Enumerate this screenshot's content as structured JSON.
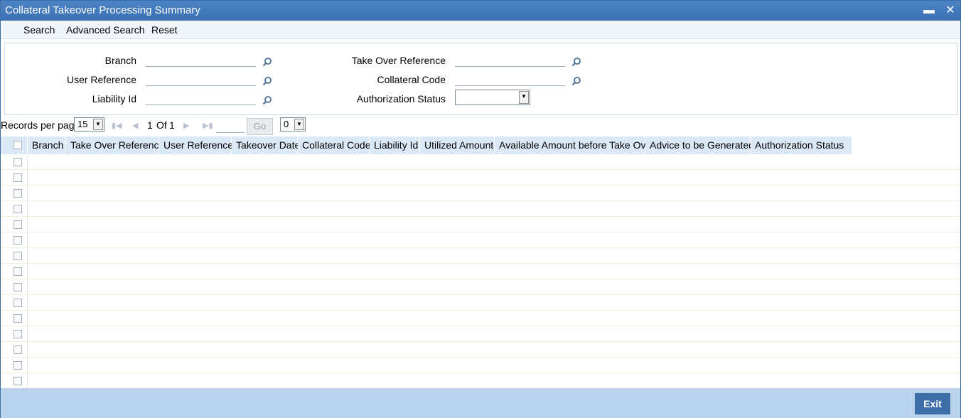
{
  "window": {
    "title": "Collateral Takeover Processing Summary",
    "minimize_icon": "minimize-icon",
    "close_icon": "close-icon"
  },
  "menu": {
    "search": "Search",
    "advanced_search": "Advanced Search",
    "reset": "Reset"
  },
  "criteria": {
    "branch": {
      "label": "Branch",
      "value": ""
    },
    "user_reference": {
      "label": "User Reference",
      "value": ""
    },
    "liability_id": {
      "label": "Liability Id",
      "value": ""
    },
    "take_over_reference": {
      "label": "Take Over Reference",
      "value": ""
    },
    "collateral_code": {
      "label": "Collateral Code",
      "value": ""
    },
    "authorization_status": {
      "label": "Authorization Status",
      "value": ""
    }
  },
  "pager": {
    "records_per_page_label": "Records per page",
    "records_per_page": "15",
    "current_page": "1",
    "of_label": "Of",
    "total_pages": "1",
    "go_label": "Go",
    "extra_select": "0"
  },
  "grid": {
    "columns": [
      "Branch",
      "Take Over Reference",
      "User Reference",
      "Takeover Date",
      "Collateral Code",
      "Liability Id",
      "Utilized Amount",
      "Available Amount before Take Over",
      "Advice to be Generated",
      "Authorization Status"
    ],
    "row_count": 15
  },
  "footer": {
    "exit_label": "Exit"
  },
  "colors": {
    "titlebar": "#3a70b3",
    "header_bg": "#dbe8f5",
    "footer_bg": "#b9d3ec",
    "button": "#3d6ea8"
  }
}
